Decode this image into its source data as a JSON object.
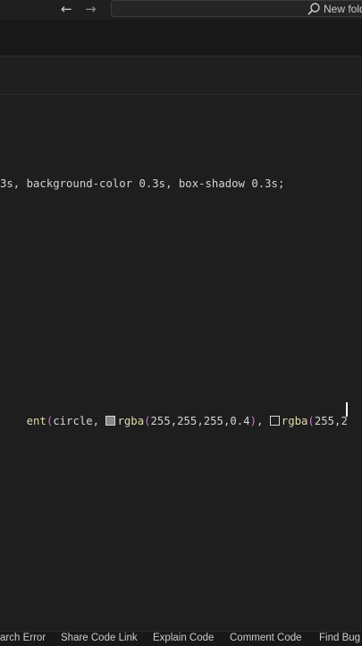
{
  "titlebar": {
    "back_icon": "arrow-left-icon",
    "forward_icon": "arrow-right-icon",
    "search_icon": "search-icon",
    "search_text": "New fold"
  },
  "editor": {
    "lines": [
      {
        "text": "3s, background-color 0.3s, box-shadow 0.3s;"
      }
    ],
    "gradient_line": {
      "fn_tail": "ent",
      "open_paren": "(",
      "arg1": "circle, ",
      "color1_fn": "rgba",
      "color1_args": "255,255,255,0.4",
      "sep": ", ",
      "color2_fn": "rgba",
      "color2_args_partial": "255,2",
      "swatch1_color": "#888888",
      "swatch2_color": "#1e1e1e"
    }
  },
  "statusbar": {
    "items": [
      "arch Error",
      "Share Code Link",
      "Explain Code",
      "Comment Code",
      "Find Bug"
    ]
  }
}
